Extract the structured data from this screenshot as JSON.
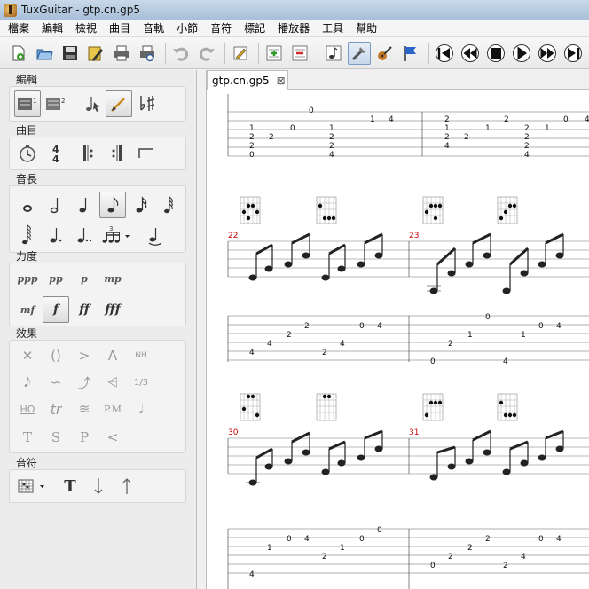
{
  "window": {
    "title": "TuxGuitar - gtp.cn.gp5"
  },
  "menu": [
    "檔案",
    "編輯",
    "檢視",
    "曲目",
    "音軌",
    "小節",
    "音符",
    "標記",
    "播放器",
    "工具",
    "幫助"
  ],
  "toolbar": {
    "buttons": [
      "new-file",
      "open-file",
      "save",
      "edit-properties",
      "print",
      "print-preview",
      "undo",
      "redo",
      "pencil-edit",
      "add-track",
      "remove-track",
      "note-view",
      "tuning-tool",
      "guitar-tool",
      "flag-marker"
    ],
    "transport": [
      "previous-icon",
      "rewind-icon",
      "stop-icon",
      "play-icon",
      "forward-icon",
      "next-icon"
    ]
  },
  "panel": {
    "groups": {
      "edit": "編輯",
      "song": "曲目",
      "duration": "音長",
      "dynamics": "力度",
      "effects": "效果",
      "note": "音符"
    },
    "edit_labels": {
      "track1": "1",
      "track2": "2"
    },
    "time_sig": {
      "top": "4",
      "bottom": "4"
    },
    "triplet": "3",
    "dynamics_row1": [
      "ppp",
      "pp",
      "p",
      "mp"
    ],
    "dynamics_row2": [
      "mf",
      "f",
      "ff",
      "fff"
    ],
    "effects_row1": [
      "✕",
      "()",
      ">",
      "Λ",
      "NH"
    ],
    "effects_row2": [
      "𝅘𝅥𝅮",
      "∽",
      "⤴",
      "⩤",
      "1/3"
    ],
    "effects_row3": [
      "HO",
      "tr",
      "≋",
      "P.M",
      "𝅘𝅥"
    ],
    "effects_row4": [
      "T",
      "S",
      "P",
      "<"
    ]
  },
  "document": {
    "tab_label": "gtp.cn.gp5",
    "close_glyph": "⊠",
    "measures": {
      "m22": "22",
      "m23": "23",
      "m30": "30",
      "m31": "31"
    },
    "top_system": {
      "left": [
        "0",
        "1",
        "1",
        "0",
        "4",
        "1",
        "2",
        "2",
        "2",
        "2",
        "2",
        "0",
        "4"
      ],
      "right": [
        "2",
        "1",
        "2",
        "2",
        "1",
        "1",
        "0",
        "4",
        "2",
        "2",
        "4",
        "4",
        "2",
        "2"
      ]
    },
    "system2": {
      "left": [
        "2",
        "0",
        "4",
        "2",
        "4",
        "4",
        "2",
        "4"
      ],
      "right": [
        "0",
        "1",
        "0",
        "1",
        "4",
        "2",
        "0",
        "4"
      ]
    },
    "system3": {
      "left": [
        "0",
        "0",
        "4",
        "0",
        "1",
        "2",
        "1",
        "4"
      ],
      "right": [
        "2",
        "0",
        "4",
        "2",
        "4",
        "2",
        "0",
        "2"
      ]
    }
  }
}
